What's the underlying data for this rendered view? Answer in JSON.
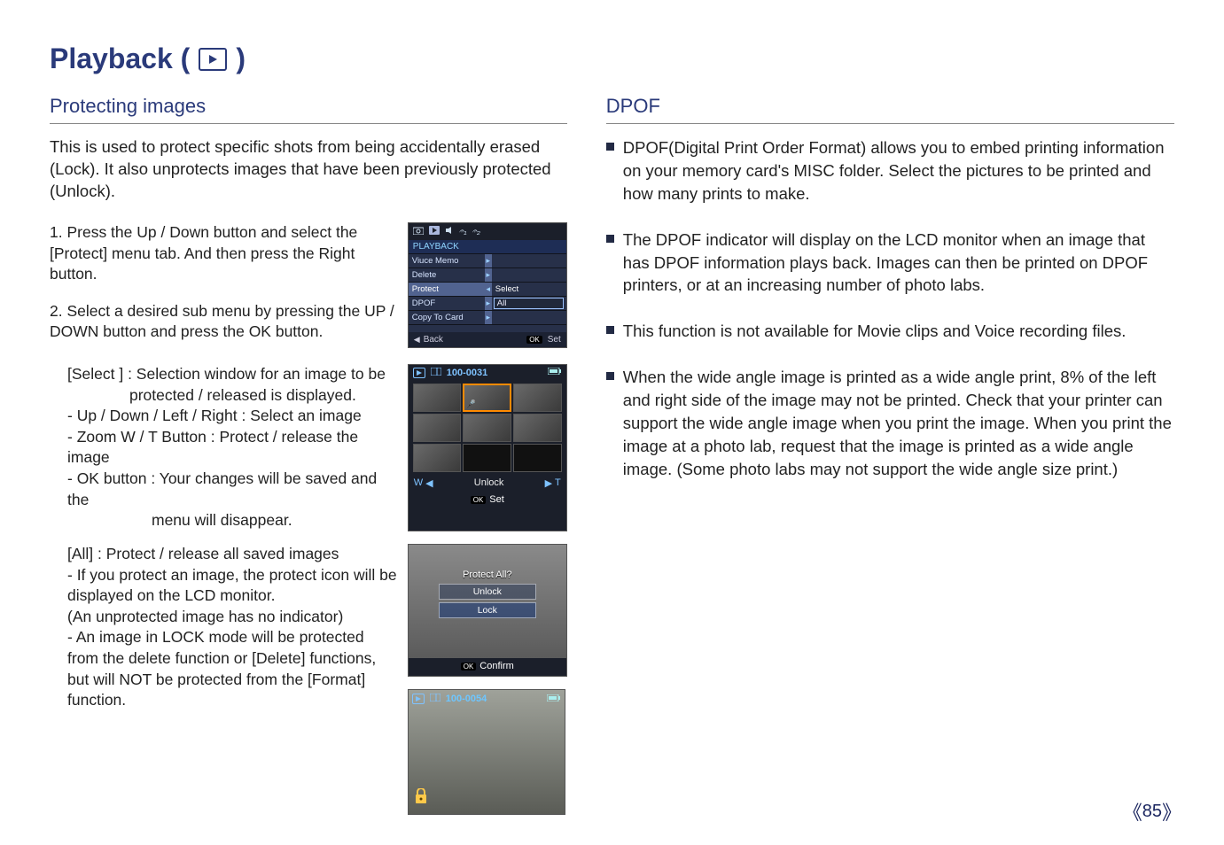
{
  "title": "Playback (",
  "titleEnd": ")",
  "left": {
    "heading": "Protecting images",
    "intro": "This is used to protect specific shots from being accidentally erased (Lock). It also unprotects images that have been previously protected (Unlock).",
    "step1": "1. Press the Up / Down button and select the [Protect] menu tab. And then press the Right button.",
    "step2": "2. Select a desired sub menu by pressing the UP / DOWN button and press the OK button.",
    "selectLine": "[Select ] : Selection window for an image to be",
    "selectLine2": "protected / released is displayed.",
    "sub1": "- Up / Down / Left / Right : Select an image",
    "sub2": "- Zoom W / T Button : Protect / release the image",
    "sub3": "- OK button : Your changes will be saved and the",
    "sub3b": "menu will disappear.",
    "allLine": "[All] : Protect / release all saved images",
    "allSub1": "- If you protect an image, the protect icon will be displayed on the LCD monitor.",
    "allSub1b": "(An unprotected image has no indicator)",
    "allSub2": "- An image in LOCK mode will be protected from the delete function or [Delete] functions, but will NOT be protected from the [Format] function."
  },
  "menuScreen": {
    "header": "PLAYBACK",
    "rows": {
      "r1": "Viuce Memo",
      "r2": "Delete",
      "r3": "Protect",
      "r3opt": "Select",
      "r4": "DPOF",
      "r4opt": "All",
      "r5": "Copy To Card"
    },
    "footBack": "Back",
    "footSet": "Set",
    "ok": "OK"
  },
  "thumbScreen": {
    "num": "100-0031",
    "unlock": "Unlock",
    "w": "W",
    "t": "T",
    "ok": "OK",
    "set": "Set"
  },
  "photoScreen": {
    "title": "Protect  All?",
    "opt1": "Unlock",
    "opt2": "Lock",
    "ok": "OK",
    "confirm": "Confirm"
  },
  "singleScreen": {
    "num": "100-0054"
  },
  "right": {
    "heading": "DPOF",
    "b1": "DPOF(Digital Print Order Format) allows you to embed printing information on your memory card's MISC folder. Select the pictures to be printed and how many prints to make.",
    "b2": "The DPOF indicator will display on the LCD monitor when an image that has DPOF information plays back. Images can then be printed on DPOF printers, or at an increasing number of photo labs.",
    "b3": "This function is not available for Movie clips and Voice recording files.",
    "b4": "When the wide angle image is printed as a wide angle print, 8% of the left and right side of the image may not be printed. Check that your printer can support the wide angle image when you print the image. When you print the image at a photo lab, request that the image is printed as a wide angle image. (Some photo labs may not support the wide angle size print.)"
  },
  "pageNum": "85"
}
